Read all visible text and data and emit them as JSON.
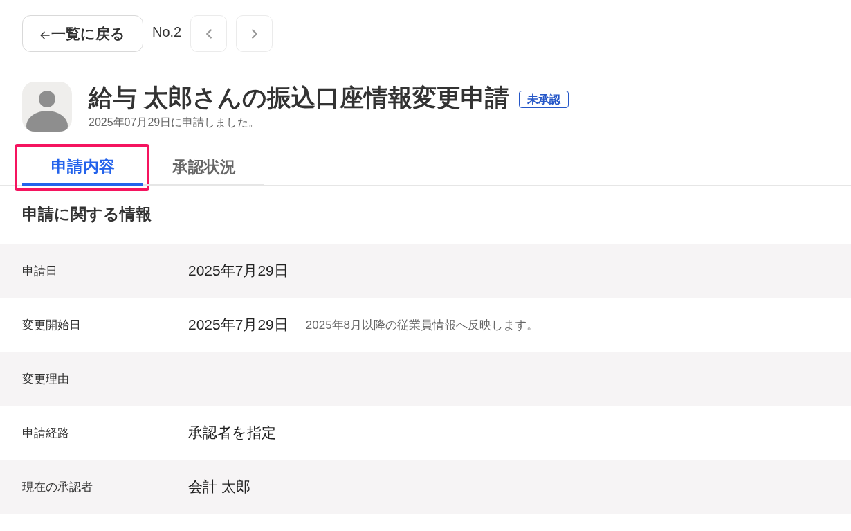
{
  "top_bar": {
    "back_button": {
      "label": "一覧に戻る"
    },
    "record_number": "No.2"
  },
  "header": {
    "title": "給与 太郎さんの振込口座情報変更申請",
    "status_badge": {
      "label": "未承認",
      "kind": "pending"
    },
    "subtitle": "2025年07月29日に申請しました。"
  },
  "tabs": [
    {
      "label": "申請内容",
      "selected": true,
      "highlighted": true
    },
    {
      "label": "承認状況",
      "selected": false,
      "highlighted": false
    }
  ],
  "section": {
    "heading": "申請に関する情報",
    "rows": [
      {
        "label": "申請日",
        "value": "2025年7月29日"
      },
      {
        "label": "変更開始日",
        "value": "2025年7月29日",
        "note": "2025年8月以降の従業員情報へ反映します。"
      },
      {
        "label": "変更理由"
      },
      {
        "label": "申請経路",
        "value": "承認者を指定"
      },
      {
        "label": "現在の承認者",
        "value": "会計 太郎"
      }
    ]
  }
}
